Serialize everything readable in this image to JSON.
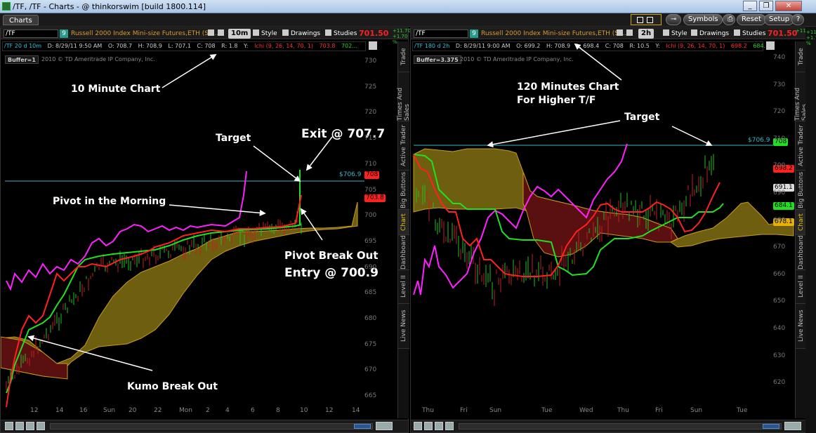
{
  "window": {
    "title": "/TF, /TF - Charts - @ thinkorswim [build 1800.114]"
  },
  "toolbar": {
    "tab": "Charts",
    "symbols": "Symbols",
    "reset": "Reset",
    "setup": "Setup",
    "help": "?"
  },
  "left": {
    "symbol": "/TF",
    "badge": "9",
    "description": "Russell 2000 Index Mini-size Futures,ETH (SE...",
    "timeframe": "10m",
    "style": "Style",
    "drawings": "Drawings",
    "studies": "Studies",
    "last": "701.50",
    "change_top": "+11.70",
    "change_bottom": "+1.70 %",
    "info": {
      "period": "/TF 20 d 10m",
      "d": "D: 8/29/11 9:50 AM",
      "o": "O: 708.7",
      "h": "H: 708.9",
      "l": "L: 707.1",
      "c": "C: 708",
      "r": "R: 1.8",
      "y": "Y:",
      "ichi": "Ichi (9, 26, 14, 70, 1)",
      "v1": "703.8",
      "v2": "702..."
    },
    "buffer": "Buffer=1",
    "copyright": "2010 © TD Ameritrade IP Company, Inc.",
    "price_axis": [
      "730",
      "725",
      "720",
      "715",
      "710",
      "705",
      "700",
      "695",
      "690",
      "685",
      "680",
      "675",
      "670",
      "665"
    ],
    "tags": {
      "target": "$706.9",
      "red": "708",
      "red2": "703.8"
    },
    "x_axis": [
      "12",
      "14",
      "16",
      "Sun",
      "20",
      "22",
      "Mon",
      "2",
      "4",
      "6",
      "8",
      "10",
      "12",
      "14"
    ],
    "annotations": {
      "ten_min": "10 Minute Chart",
      "target": "Target",
      "exit": "Exit @ 707.7",
      "pivot_morning": "Pivot in the Morning",
      "pivot_break": "Pivot Break Out",
      "entry": "Entry @ 700.9",
      "kumo": "Kumo Break Out"
    },
    "side_tabs": [
      "Trade",
      "Times And Sales",
      "Active Trader",
      "Big Buttons",
      "Chart",
      "Dashboard",
      "Level II",
      "Live News"
    ]
  },
  "right": {
    "symbol": "/TF",
    "badge": "9",
    "description": "Russell 2000 Index Mini-size Futures,ETH (SE...",
    "timeframe": "2h",
    "style": "Style",
    "drawings": "Drawings",
    "studies": "Studies",
    "last": "701.50",
    "change_top": "+11.70",
    "change_bottom": "+1.70 %",
    "info": {
      "period": "/TF 180 d 2h",
      "d": "D: 8/29/11 9:00 AM",
      "o": "O: 699.2",
      "h": "H: 708.9",
      "l": "L: 698.4",
      "c": "C: 708",
      "r": "R: 10.5",
      "y": "Y:",
      "ichi": "Ichi (9, 26, 14, 70, 1)",
      "v1": "698.2",
      "v2": "684..."
    },
    "buffer": "Buffer=3.375",
    "copyright": "2010 © TD Ameritrade IP Company, Inc.",
    "price_axis": [
      "740",
      "730",
      "720",
      "710",
      "700",
      "690",
      "680",
      "670",
      "660",
      "650",
      "640",
      "630",
      "620"
    ],
    "tags": {
      "target": "$706.9",
      "green": "708",
      "red": "698.2",
      "gray": "691.1",
      "green2": "684.1",
      "orange": "678.1"
    },
    "x_axis": [
      "Thu",
      "Fri",
      "Sun",
      "Tue",
      "Wed",
      "Thu",
      "Fri",
      "Sun",
      "Tue"
    ],
    "annotations": {
      "chart_line1": "120 Minutes Chart",
      "chart_line2": "For Higher T/F",
      "target": "Target"
    },
    "side_tabs": [
      "Trade",
      "Times And Sales",
      "Active Trader",
      "Big Buttons",
      "Chart",
      "Dashboard",
      "Level II",
      "Live News"
    ]
  },
  "far_right": {
    "change_top": "+11.70",
    "change_bottom": "+1.70 %"
  },
  "colors": {
    "cloud": "#6e5f10",
    "cloud_red": "#5a1010",
    "tenkan": "#ff2020",
    "kijun": "#20e020",
    "lagging": "#ff20ff",
    "target_line": "#3bb6c4",
    "last_price": "#ff2020"
  }
}
